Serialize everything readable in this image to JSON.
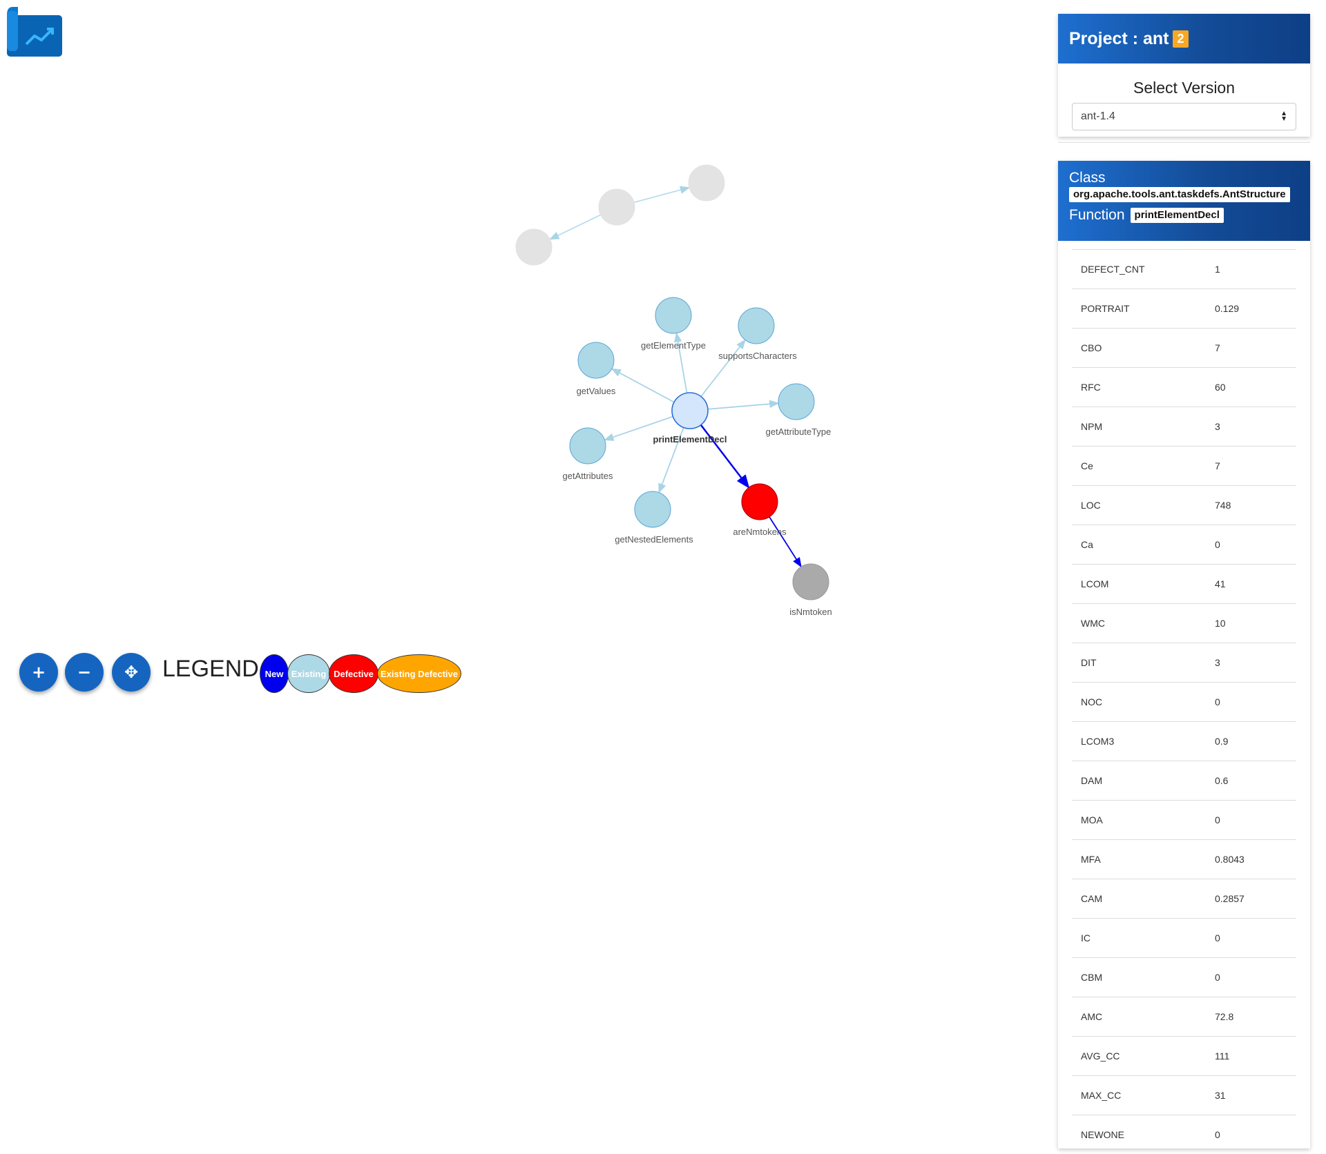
{
  "app": {
    "logo_icon": "trending-chart-icon"
  },
  "graph": {
    "nodes": [
      {
        "id": "printElementDecl",
        "label": "printElementDecl",
        "status": "focus"
      },
      {
        "id": "getElementType",
        "label": "getElementType",
        "status": "existing"
      },
      {
        "id": "supportsCharacters",
        "label": "supportsCharacters",
        "status": "existing"
      },
      {
        "id": "getValues",
        "label": "getValues",
        "status": "existing"
      },
      {
        "id": "getAttributeType",
        "label": "getAttributeType",
        "status": "existing"
      },
      {
        "id": "getAttributes",
        "label": "getAttributes",
        "status": "existing"
      },
      {
        "id": "getNestedElements",
        "label": "getNestedElements",
        "status": "existing"
      },
      {
        "id": "areNmtokens",
        "label": "areNmtokens",
        "status": "defective"
      },
      {
        "id": "isNmtoken",
        "label": "isNmtoken",
        "status": "other"
      },
      {
        "id": "faded1",
        "label": "",
        "status": "faded"
      },
      {
        "id": "faded2",
        "label": "",
        "status": "faded"
      },
      {
        "id": "faded3",
        "label": "",
        "status": "faded"
      }
    ],
    "edges": [
      [
        "printElementDecl",
        "getElementType"
      ],
      [
        "printElementDecl",
        "supportsCharacters"
      ],
      [
        "printElementDecl",
        "getValues"
      ],
      [
        "printElementDecl",
        "getAttributeType"
      ],
      [
        "printElementDecl",
        "getAttributes"
      ],
      [
        "printElementDecl",
        "getNestedElements"
      ],
      [
        "printElementDecl",
        "areNmtokens"
      ],
      [
        "areNmtokens",
        "isNmtoken"
      ],
      [
        "faded2",
        "faded1"
      ],
      [
        "faded2",
        "faded3"
      ]
    ]
  },
  "controls": {
    "zoom_in": "+",
    "zoom_out": "−",
    "fit": "✥"
  },
  "legend": {
    "title": "LEGEND",
    "items": [
      {
        "label": "New",
        "color": "#0000ee"
      },
      {
        "label": "Existing",
        "color": "#add8e6"
      },
      {
        "label": "Defective",
        "color": "#ff0000"
      },
      {
        "label": "Existing Defective",
        "color": "#ffa500"
      }
    ]
  },
  "project": {
    "title": "Project : ant",
    "badge": "2",
    "version_label": "Select Version",
    "selected_version": "ant-1.4"
  },
  "details": {
    "class_label": "Class",
    "class_name": "org.apache.tools.ant.taskdefs.AntStructure",
    "function_label": "Function",
    "function_name": "printElementDecl",
    "metrics": [
      {
        "name": "DEFECT_CNT",
        "value": "1"
      },
      {
        "name": "PORTRAIT",
        "value": "0.129"
      },
      {
        "name": "CBO",
        "value": "7"
      },
      {
        "name": "RFC",
        "value": "60"
      },
      {
        "name": "NPM",
        "value": "3"
      },
      {
        "name": "Ce",
        "value": "7"
      },
      {
        "name": "LOC",
        "value": "748"
      },
      {
        "name": "Ca",
        "value": "0"
      },
      {
        "name": "LCOM",
        "value": "41"
      },
      {
        "name": "WMC",
        "value": "10"
      },
      {
        "name": "DIT",
        "value": "3"
      },
      {
        "name": "NOC",
        "value": "0"
      },
      {
        "name": "LCOM3",
        "value": "0.9"
      },
      {
        "name": "DAM",
        "value": "0.6"
      },
      {
        "name": "MOA",
        "value": "0"
      },
      {
        "name": "MFA",
        "value": "0.8043"
      },
      {
        "name": "CAM",
        "value": "0.2857"
      },
      {
        "name": "IC",
        "value": "0"
      },
      {
        "name": "CBM",
        "value": "0"
      },
      {
        "name": "AMC",
        "value": "72.8"
      },
      {
        "name": "AVG_CC",
        "value": "111"
      },
      {
        "name": "MAX_CC",
        "value": "31"
      },
      {
        "name": "NEWONE",
        "value": "0"
      }
    ]
  }
}
